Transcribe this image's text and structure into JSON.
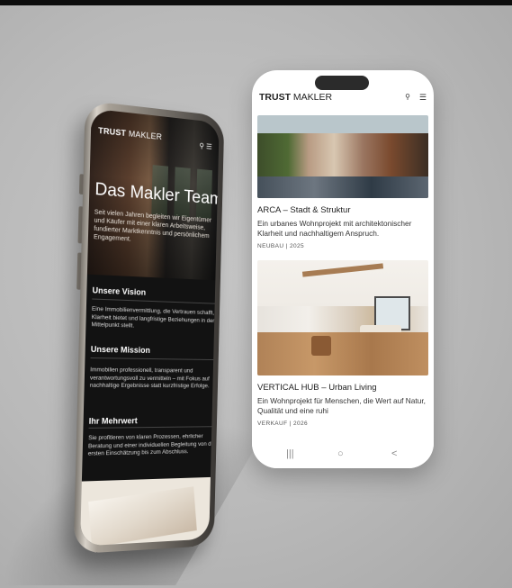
{
  "left_phone": {
    "logo_bold": "TRUST",
    "logo_light": " MAKLER",
    "search_icon": "search-icon",
    "menu_icon": "menu-icon",
    "hero_title": "Das Makler Team.",
    "hero_intro": "Seit vielen Jahren begleiten wir Eigentümer und Käufer mit einer klaren Arbeitsweise, fundierter Marktkenntnis und persönlichem Engagement.",
    "sections": [
      {
        "heading": "Unsere Vision",
        "text": "Eine Immobilienvermittlung, die Vertrauen schafft, Klarheit bietet und langfristige Beziehungen in den Mittelpunkt stellt."
      },
      {
        "heading": "Unsere Mission",
        "text": "Immobilien professionell, transparent und verantwortungsvoll zu vermitteln – mit Fokus auf nachhaltige Ergebnisse statt kurzfristige Erfolge."
      },
      {
        "heading": "Ihr Mehrwert",
        "text": "Sie profitieren von klaren Prozessen, ehrlicher Beratung und einer individuellen Begleitung von der ersten Einschätzung bis zum Abschluss."
      }
    ]
  },
  "right_phone": {
    "logo_bold": "TRUST",
    "logo_light": " MAKLER",
    "search_glyph": "⚲",
    "menu_glyph": "☰",
    "cards": [
      {
        "title": "ARCA – Stadt & Struktur",
        "text": "Ein urbanes Wohnprojekt mit architektonischer Klarheit und nachhaltigem Anspruch.",
        "meta": "NEUBAU | 2025"
      },
      {
        "title": "VERTICAL HUB – Urban Living",
        "text": "Ein Wohnprojekt für Menschen, die Wert auf Natur, Qualität und eine ruhi",
        "meta": "VERKAUF | 2026"
      }
    ],
    "nav": {
      "recent": "|||",
      "home": "○",
      "back": "<"
    }
  },
  "colors": {
    "background": "#bdbdbd",
    "dark_screen": "#121212",
    "card_bg": "#ffffff"
  }
}
